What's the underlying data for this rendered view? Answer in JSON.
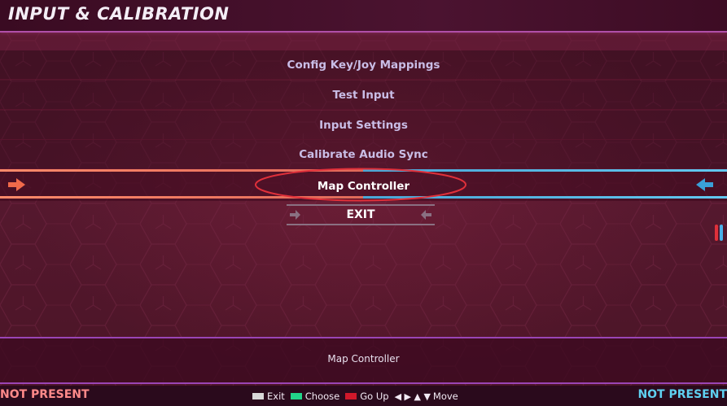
{
  "header": {
    "title": "INPUT & CALIBRATION"
  },
  "menu": {
    "items": [
      {
        "label": "Config Key/Joy Mappings"
      },
      {
        "label": "Test Input"
      },
      {
        "label": "Input Settings"
      },
      {
        "label": "Calibrate Audio Sync"
      },
      {
        "label": "Map Controller",
        "selected": true
      }
    ],
    "exit_label": "EXIT"
  },
  "description": "Map Controller",
  "footer": {
    "player1_status": "NOT PRESENT",
    "player2_status": "NOT PRESENT",
    "hints": {
      "exit": "Exit",
      "choose": "Choose",
      "go_up": "Go Up",
      "move": "Move",
      "move_glyphs": "◀ ▶ ▲ ▼"
    }
  },
  "colors": {
    "player1": "#ff8a8a",
    "player2": "#5fd0f0",
    "exit_key": "#d8d8d8",
    "choose_key": "#22d48a",
    "goup_key": "#d0182a",
    "highlight_ring": "#e0303a"
  }
}
